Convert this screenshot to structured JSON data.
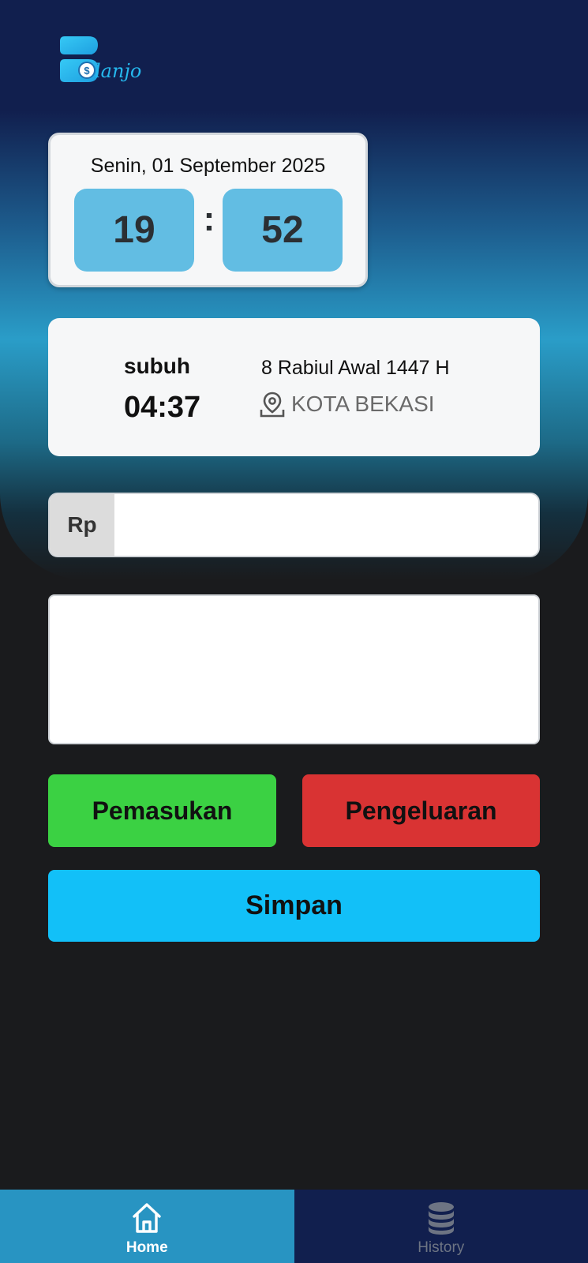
{
  "app": {
    "logo_text": "lanjo"
  },
  "clock": {
    "date": "Senin, 01 September 2025",
    "hour": "19",
    "minute": "52",
    "separator": ":"
  },
  "prayer": {
    "name": "subuh",
    "time": "04:37",
    "hijri_date": "8 Rabiul Awal 1447 H",
    "location": "KOTA BEKASI",
    "location_icon": "map-pin-icon"
  },
  "form": {
    "currency_prefix": "Rp",
    "amount_value": "",
    "note_value": ""
  },
  "buttons": {
    "income": "Pemasukan",
    "expense": "Pengeluaran",
    "save": "Simpan"
  },
  "nav": {
    "home": {
      "label": "Home",
      "icon": "home-icon",
      "active": true
    },
    "history": {
      "label": "History",
      "icon": "database-icon",
      "active": false
    }
  },
  "colors": {
    "income": "#3bd143",
    "expense": "#d93333",
    "save": "#12c0f8",
    "clock_box": "#62bde3",
    "nav_active": "#2894c2",
    "nav_inactive": "#111f4e"
  }
}
